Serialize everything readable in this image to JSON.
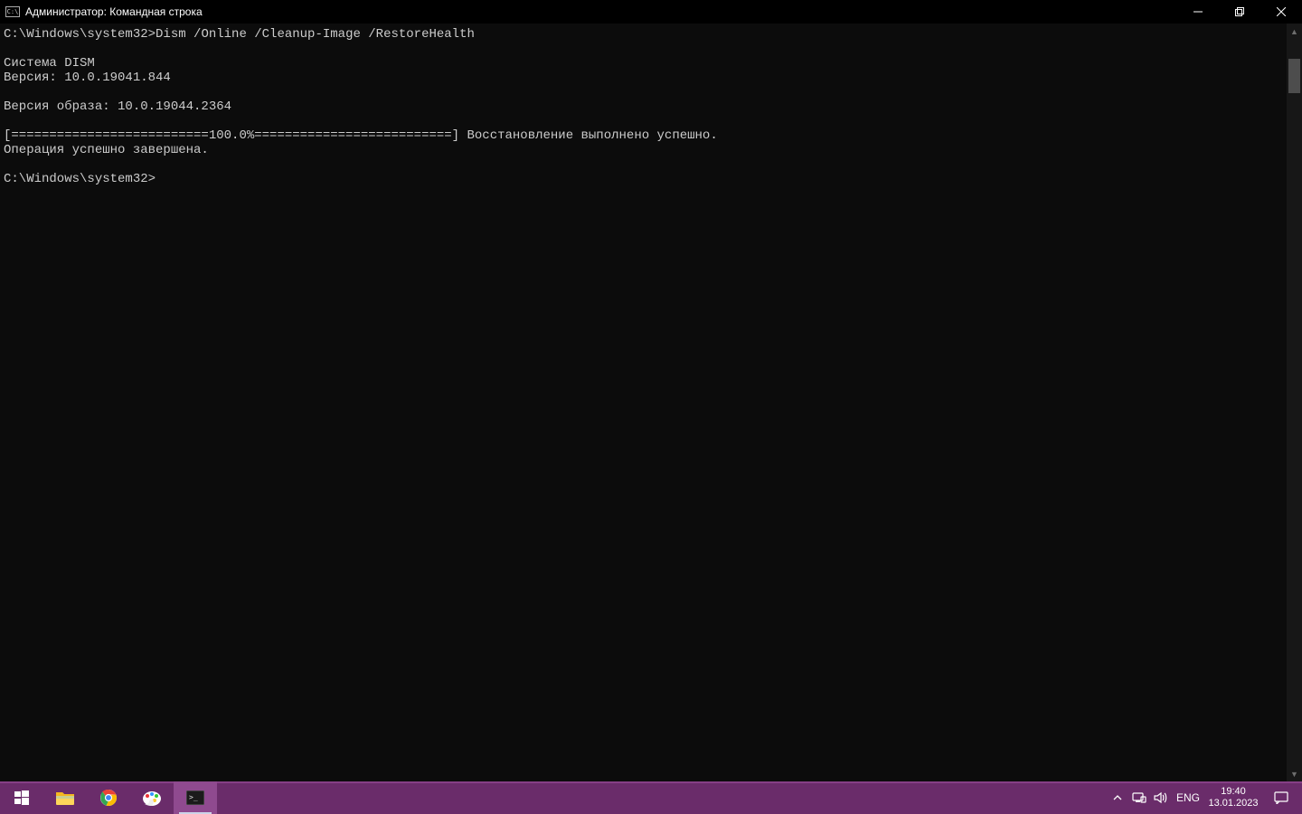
{
  "window": {
    "title": "Администратор: Командная строка"
  },
  "console": {
    "lines": [
      {
        "prompt": "C:\\Windows\\system32>",
        "cmd": "Dism /Online /Cleanup-Image /RestoreHealth"
      },
      "",
      "Cистема DISM",
      "Версия: 10.0.19041.844",
      "",
      "Версия образа: 10.0.19044.2364",
      "",
      "[==========================100.0%==========================] Восстановление выполнено успешно.",
      "Операция успешно завершена.",
      "",
      {
        "prompt": "C:\\Windows\\system32>",
        "cmd": ""
      }
    ]
  },
  "taskbar": {
    "lang": "ENG",
    "time": "19:40",
    "date": "13.01.2023"
  }
}
